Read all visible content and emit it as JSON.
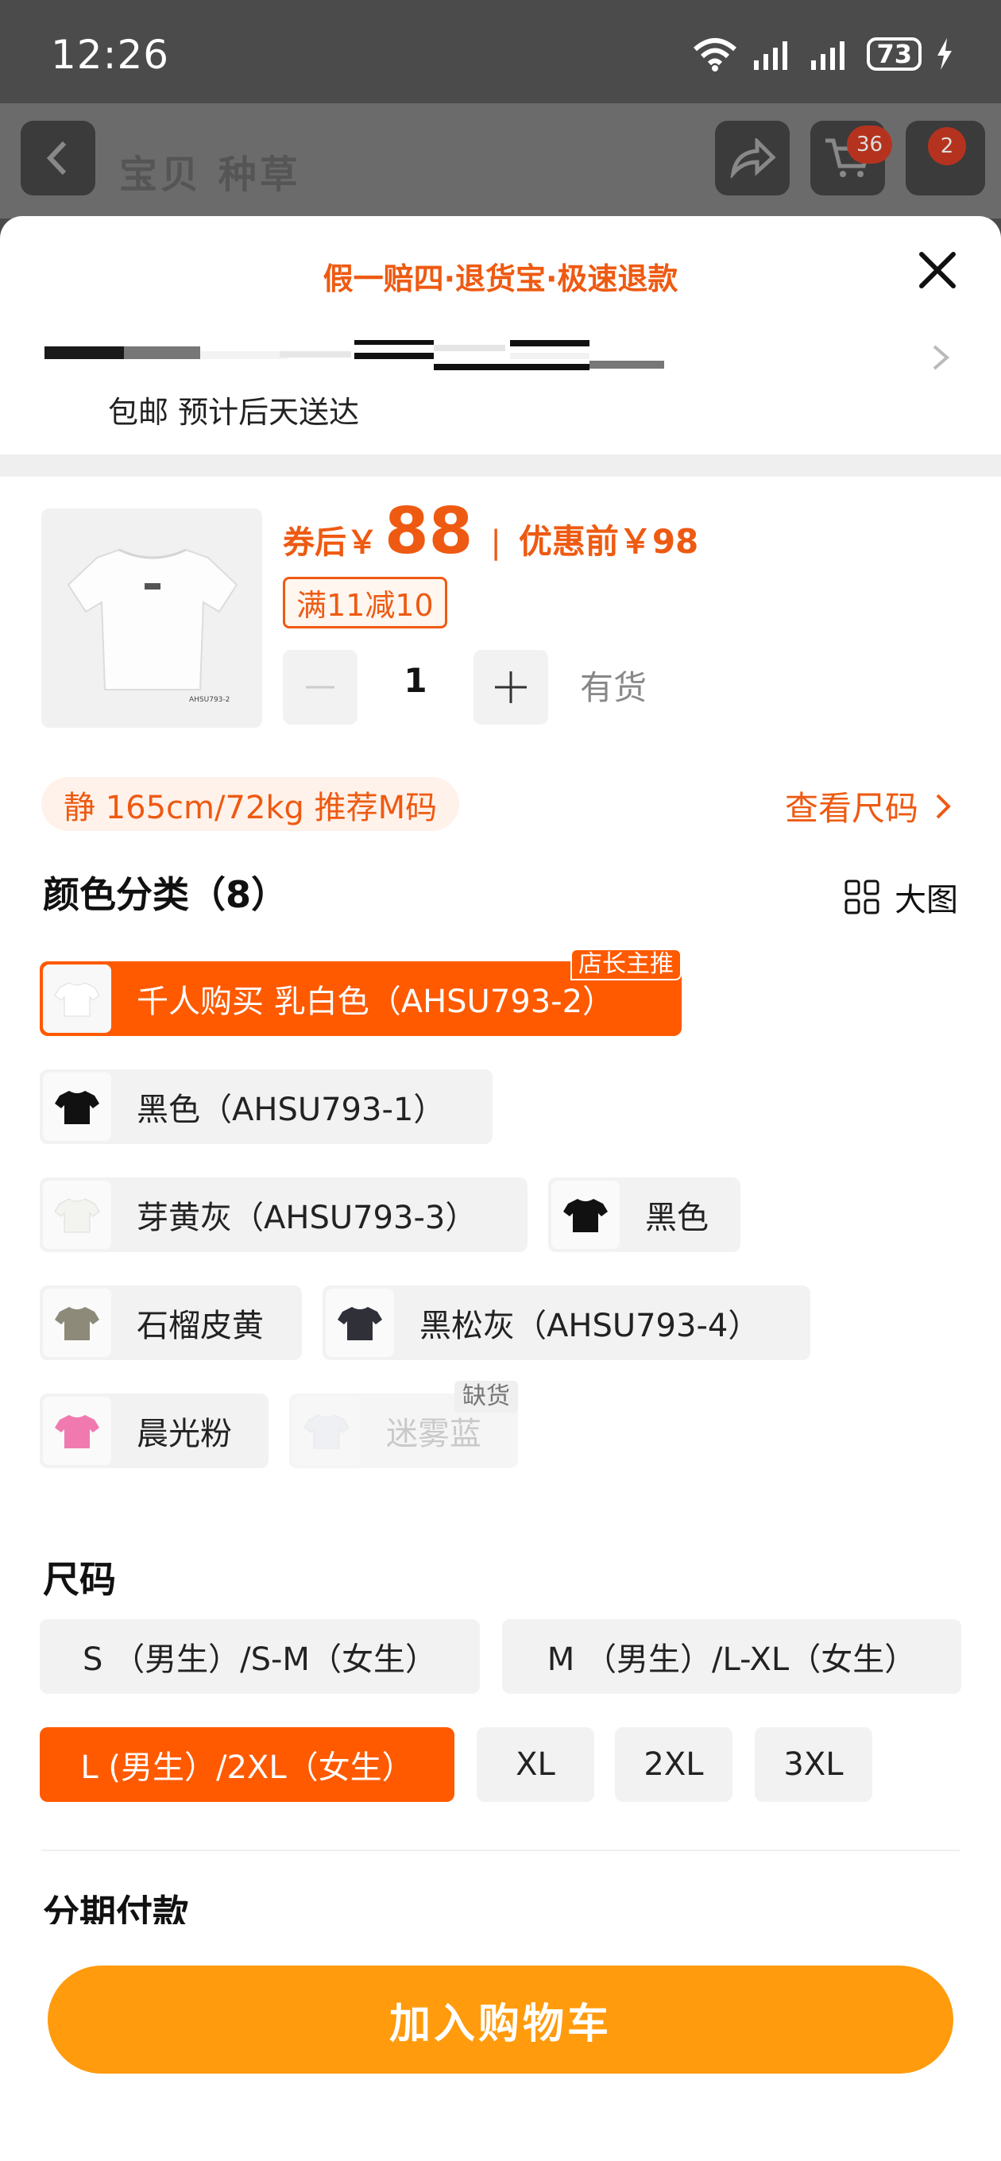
{
  "status_bar": {
    "time": "12:26",
    "battery": "73"
  },
  "background_header": {
    "tabs": "宝贝  种草",
    "cart_badge": "36",
    "more_badge": "2"
  },
  "sheet": {
    "guarantee": "假一赔四·退货宝·极速退款",
    "shipping": "包邮 预计后天送达"
  },
  "product": {
    "price_label": "券后￥",
    "price": "88",
    "price_sep": "|",
    "original_price": "优惠前￥98",
    "coupon": "满11减10",
    "quantity": "1",
    "stock": "有货",
    "thumb_caption": "AHSU793-2"
  },
  "recommendation": {
    "text": "静 165cm/72kg 推荐M码",
    "size_chart": "查看尺码"
  },
  "colors": {
    "title": "颜色分类（8）",
    "big_image": "大图",
    "items": [
      {
        "label": "千人购买  乳白色（AHSU793-2）",
        "tag": "店长主推",
        "swatch": "#ffffff"
      },
      {
        "label": "黑色（AHSU793-1）",
        "swatch": "#111111"
      },
      {
        "label": "芽黄灰（AHSU793-3）",
        "swatch": "#f3f3f0"
      },
      {
        "label": "黑色",
        "swatch": "#111111"
      },
      {
        "label": "石榴皮黄",
        "swatch": "#8d8a7a"
      },
      {
        "label": "黑松灰（AHSU793-4）",
        "swatch": "#2f3038"
      },
      {
        "label": "晨光粉",
        "swatch": "#f07ab0"
      },
      {
        "label": "迷雾蓝",
        "tag": "缺货",
        "swatch": "#e9edf2"
      }
    ]
  },
  "sizes": {
    "title": "尺码",
    "items": [
      {
        "label": "S （男生）/S-M（女生）"
      },
      {
        "label": "M （男生）/L-XL（女生）"
      },
      {
        "label": "L (男生）/2XL（女生）"
      },
      {
        "label": "XL"
      },
      {
        "label": "2XL"
      },
      {
        "label": "3XL"
      }
    ]
  },
  "installment": {
    "title": "分期付款"
  },
  "actions": {
    "add_to_cart": "加入购物车"
  },
  "theme": {
    "accent": "#ff5a00",
    "price": "#ee5a12",
    "cart_button": "#ff9b0d"
  }
}
